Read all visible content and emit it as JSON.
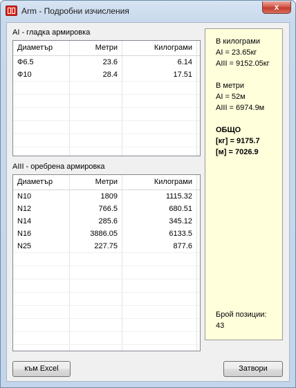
{
  "window": {
    "title": "Arm - Подробни изчисления",
    "close_label": "x"
  },
  "smooth": {
    "title": "AI - гладка армировка",
    "headers": [
      "Диаметър",
      "Метри",
      "Килограми"
    ],
    "rows": [
      [
        "Ф6.5",
        "23.6",
        "6.14"
      ],
      [
        "Ф10",
        "28.4",
        "17.51"
      ]
    ]
  },
  "ribbed": {
    "title": "AIII - оребрена армировка",
    "headers": [
      "Диаметър",
      "Метри",
      "Килограми"
    ],
    "rows": [
      [
        "N10",
        "1809",
        "1115.32"
      ],
      [
        "N12",
        "766.5",
        "680.51"
      ],
      [
        "N14",
        "285.6",
        "345.12"
      ],
      [
        "N16",
        "3886.05",
        "6133.5"
      ],
      [
        "N25",
        "227.75",
        "877.6"
      ]
    ]
  },
  "summary": {
    "kg_title": "В килограми",
    "kg_ai": "AI = 23.65кг",
    "kg_aiii": "AIII = 9152.05кг",
    "m_title": "В метри",
    "m_ai": "AI = 52м",
    "m_aiii": "AIII = 6974.9м",
    "total_title": "ОБЩО",
    "total_kg": "[кг] = 9175.7",
    "total_m": "[м] = 7026.9",
    "positions_label": "Брой позиции:",
    "positions_value": "43"
  },
  "buttons": {
    "excel": "към Excel",
    "close": "Затвори"
  }
}
